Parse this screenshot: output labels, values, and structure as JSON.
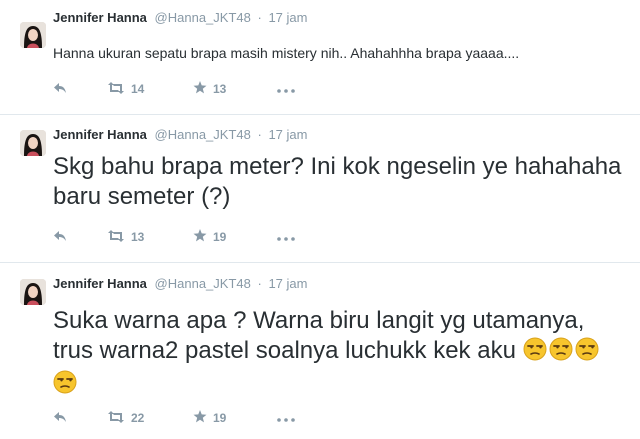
{
  "tweets": [
    {
      "name": "Jennifer Hanna",
      "handle": "@Hanna_JKT48",
      "separator": "·",
      "time": "17 jam",
      "text": "Hanna ukuran sepatu brapa masih mistery nih.. Ahahahhha brapa yaaaa....",
      "retweets": "14",
      "favorites": "13"
    },
    {
      "name": "Jennifer Hanna",
      "handle": "@Hanna_JKT48",
      "separator": "·",
      "time": "17 jam",
      "text": "Skg bahu brapa meter? Ini kok ngeselin ye hahahaha baru semeter (?)",
      "retweets": "13",
      "favorites": "19"
    },
    {
      "name": "Jennifer Hanna",
      "handle": "@Hanna_JKT48",
      "separator": "·",
      "time": "17 jam",
      "text": "Suka warna apa ? Warna biru langit yg utamanya, trus warna2 pastel soalnya luchukk kek aku",
      "emoji_count": 4,
      "emoji_icon": "unamused-face-emoji",
      "retweets": "22",
      "favorites": "19"
    }
  ],
  "icons": {
    "reply": "reply-icon",
    "retweet": "retweet-icon",
    "favorite": "star-icon",
    "more": "more-dots-icon"
  },
  "colors": {
    "text": "#292f33",
    "muted": "#8899a6",
    "divider": "#e1e8ed"
  }
}
